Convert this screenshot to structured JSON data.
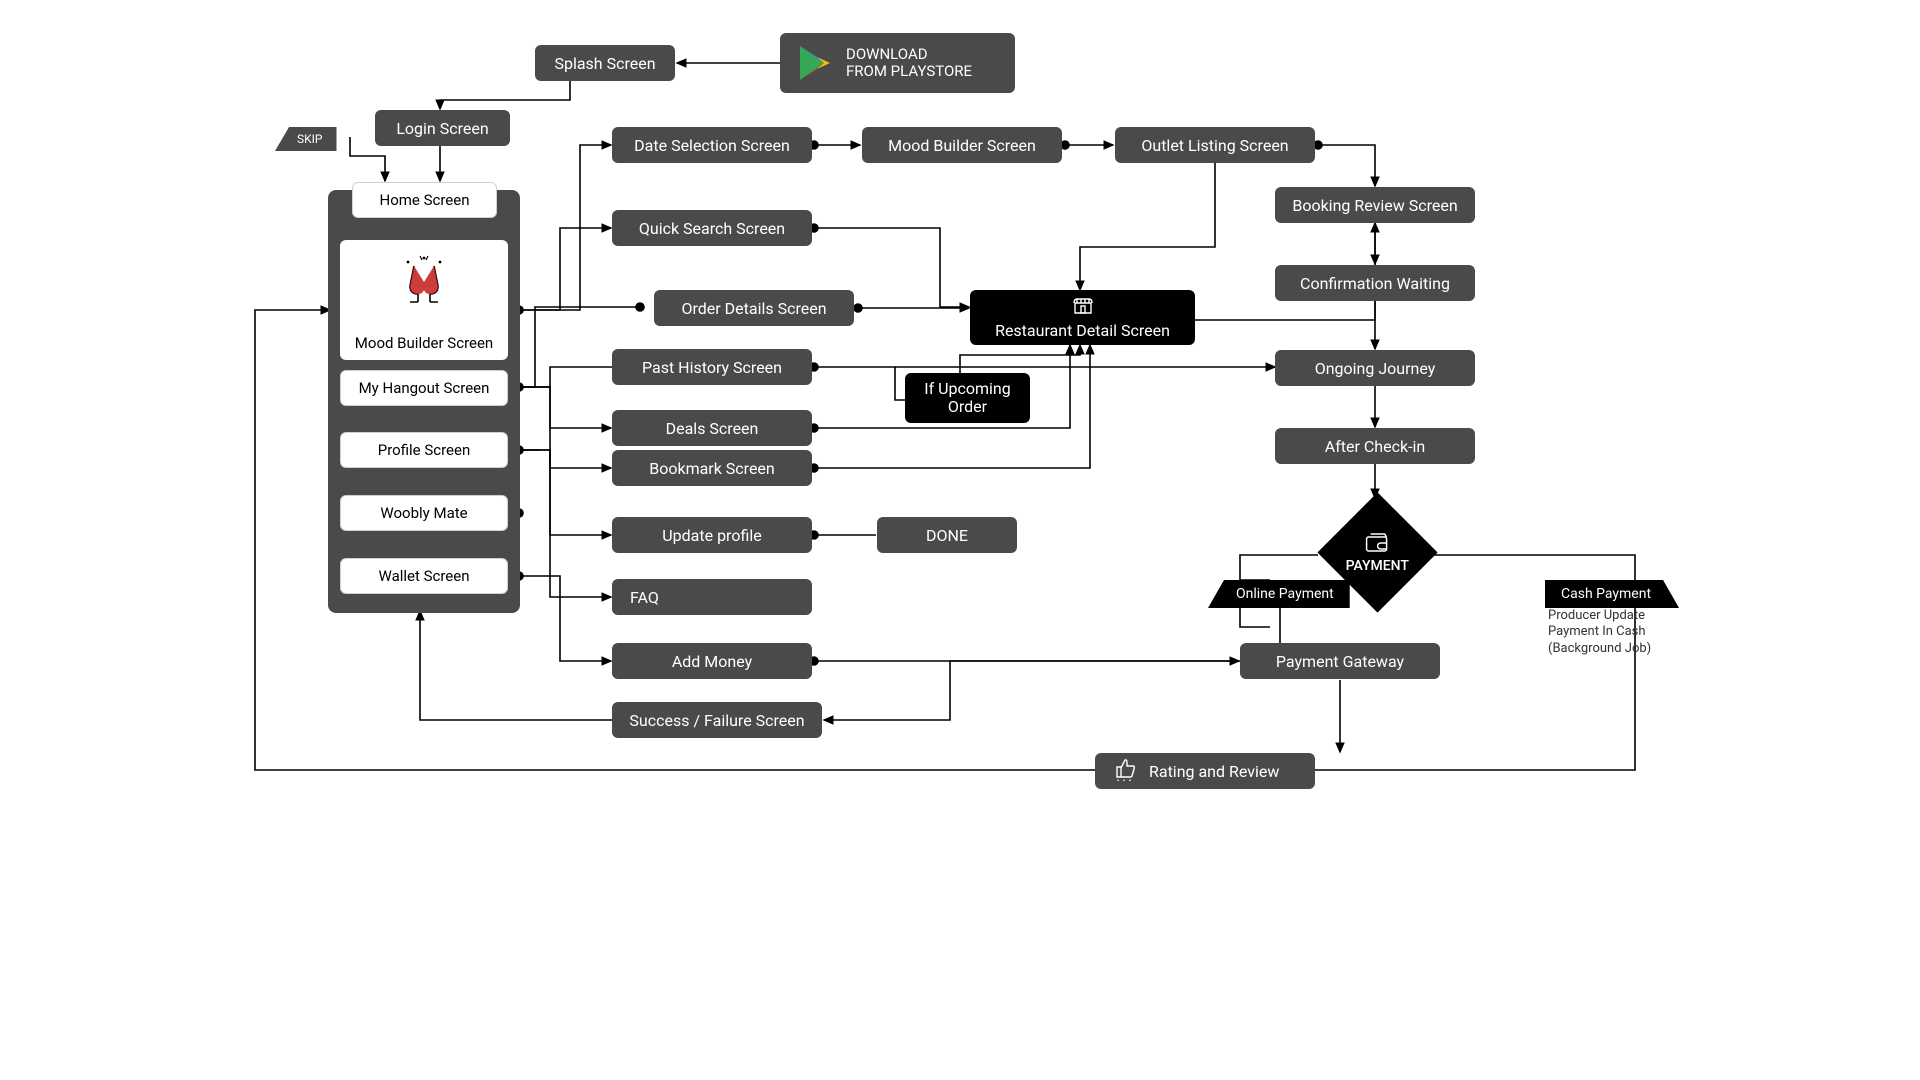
{
  "top": {
    "download_line1": "DOWNLOAD",
    "download_line2": "FROM PLAYSTORE",
    "splash": "Splash Screen",
    "login": "Login Screen",
    "skip": "SKIP",
    "home": "Home Screen"
  },
  "phone": {
    "mood_builder": "Mood Builder Screen",
    "my_hangout": "My Hangout Screen",
    "profile": "Profile Screen",
    "woobly_mate": "Woobly Mate",
    "wallet": "Wallet Screen"
  },
  "mid": {
    "date_selection": "Date Selection Screen",
    "mood_builder": "Mood Builder Screen",
    "outlet_listing": "Outlet Listing Screen",
    "quick_search": "Quick Search Screen",
    "order_details": "Order Details Screen",
    "past_history": "Past History Screen",
    "deals": "Deals Screen",
    "bookmark": "Bookmark Screen",
    "update_profile": "Update profile",
    "faq": "FAQ",
    "add_money": "Add Money",
    "success_failure": "Success / Failure Screen",
    "done": "DONE",
    "restaurant_detail": "Restaurant Detail Screen",
    "if_upcoming": "If Upcoming\nOrder"
  },
  "right": {
    "booking_review": "Booking Review Screen",
    "confirmation_waiting": "Confirmation Waiting",
    "ongoing_journey": "Ongoing Journey",
    "after_checkin": "After Check-in",
    "payment": "PAYMENT",
    "online_payment": "Online Payment",
    "cash_payment": "Cash Payment",
    "cash_note_1": "Producer Update",
    "cash_note_2": "Payment In Cash",
    "cash_note_3": "(Background Job)",
    "payment_gateway": "Payment Gateway",
    "rating_review": "Rating and Review"
  }
}
